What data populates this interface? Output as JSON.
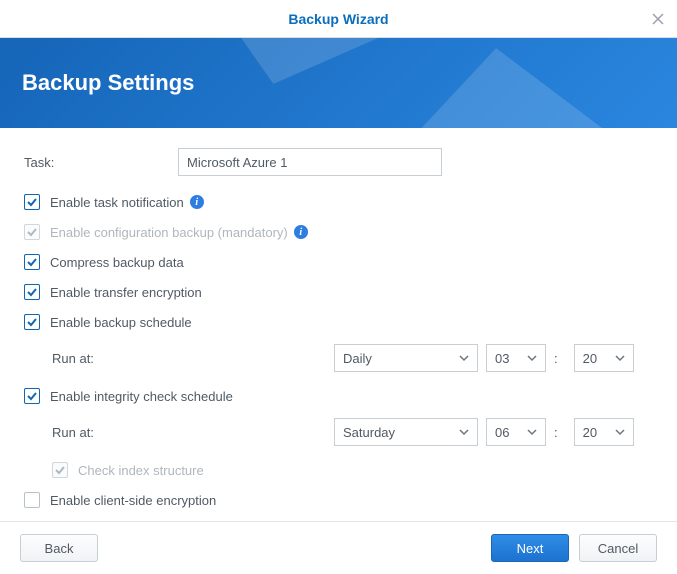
{
  "window": {
    "title": "Backup Wizard",
    "page_title": "Backup Settings"
  },
  "form": {
    "task_label": "Task:",
    "task_value": "Microsoft Azure 1",
    "enable_notification": {
      "label": "Enable task notification",
      "checked": true
    },
    "enable_config_backup": {
      "label": "Enable configuration backup (mandatory)",
      "checked": true,
      "disabled": true
    },
    "compress": {
      "label": "Compress backup data",
      "checked": true
    },
    "transfer_encryption": {
      "label": "Enable transfer encryption",
      "checked": true
    },
    "backup_schedule": {
      "label": "Enable backup schedule",
      "checked": true
    },
    "backup_run_at_label": "Run at:",
    "backup_freq": "Daily",
    "backup_hour": "03",
    "backup_min": "20",
    "integrity_schedule": {
      "label": "Enable integrity check schedule",
      "checked": true
    },
    "integrity_run_at_label": "Run at:",
    "integrity_freq": "Saturday",
    "integrity_hour": "06",
    "integrity_min": "20",
    "check_index": {
      "label": "Check index structure",
      "checked": true,
      "disabled": true
    },
    "client_encryption": {
      "label": "Enable client-side encryption",
      "checked": false
    }
  },
  "buttons": {
    "back": "Back",
    "next": "Next",
    "cancel": "Cancel"
  }
}
